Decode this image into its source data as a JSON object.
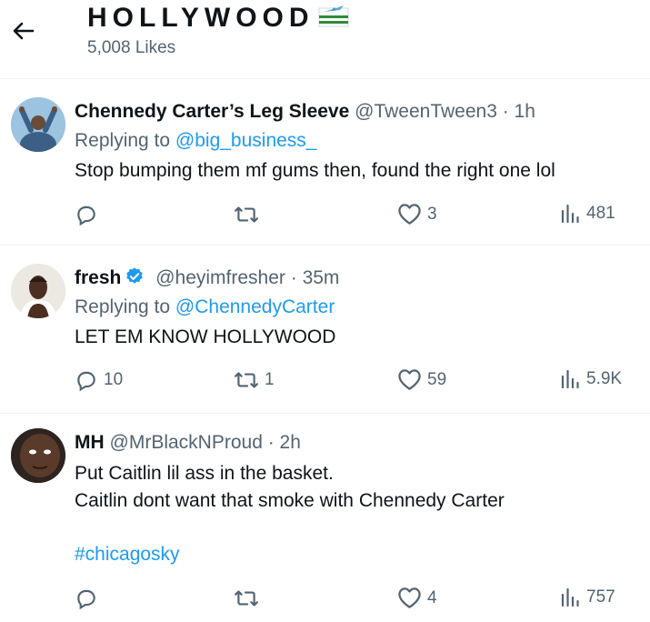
{
  "header": {
    "title": "HOLLYWOOD",
    "likes": "5,008 Likes"
  },
  "tweets": [
    {
      "name": "Chennedy Carter’s Leg Sleeve",
      "handle": "@TweenTween3",
      "time": "· 1h",
      "replying_prefix": "Replying to",
      "replying_to": "@big_business_",
      "text_lines": [
        "Stop bumping them mf gums then, found the right one lol"
      ],
      "hashtag": "",
      "reply_count": "",
      "retweet_count": "",
      "like_count": "3",
      "view_count": "481"
    },
    {
      "name": "fresh",
      "handle": "@heyimfresher",
      "time": "· 35m",
      "replying_prefix": "Replying to",
      "replying_to": "@ChennedyCarter",
      "text_lines": [
        "LET EM KNOW HOLLYWOOD"
      ],
      "hashtag": "",
      "reply_count": "10",
      "retweet_count": "1",
      "like_count": "59",
      "view_count": "5.9K"
    },
    {
      "name": "MH",
      "handle": "@MrBlackNProud",
      "time": "· 2h",
      "replying_prefix": "",
      "replying_to": "",
      "text_lines": [
        "Put Caitlin lil ass in the basket.",
        "Caitlin dont want that smoke with Chennedy Carter"
      ],
      "hashtag": "#chicagosky",
      "reply_count": "",
      "retweet_count": "",
      "like_count": "4",
      "view_count": "757"
    }
  ],
  "colors": {
    "link": "#1d9bf0",
    "muted": "#536471",
    "verified": "#1d9bf0"
  },
  "icons": [
    "back-arrow-icon",
    "flag-icon",
    "reply-icon",
    "retweet-icon",
    "like-icon",
    "views-icon",
    "verified-badge-icon"
  ]
}
